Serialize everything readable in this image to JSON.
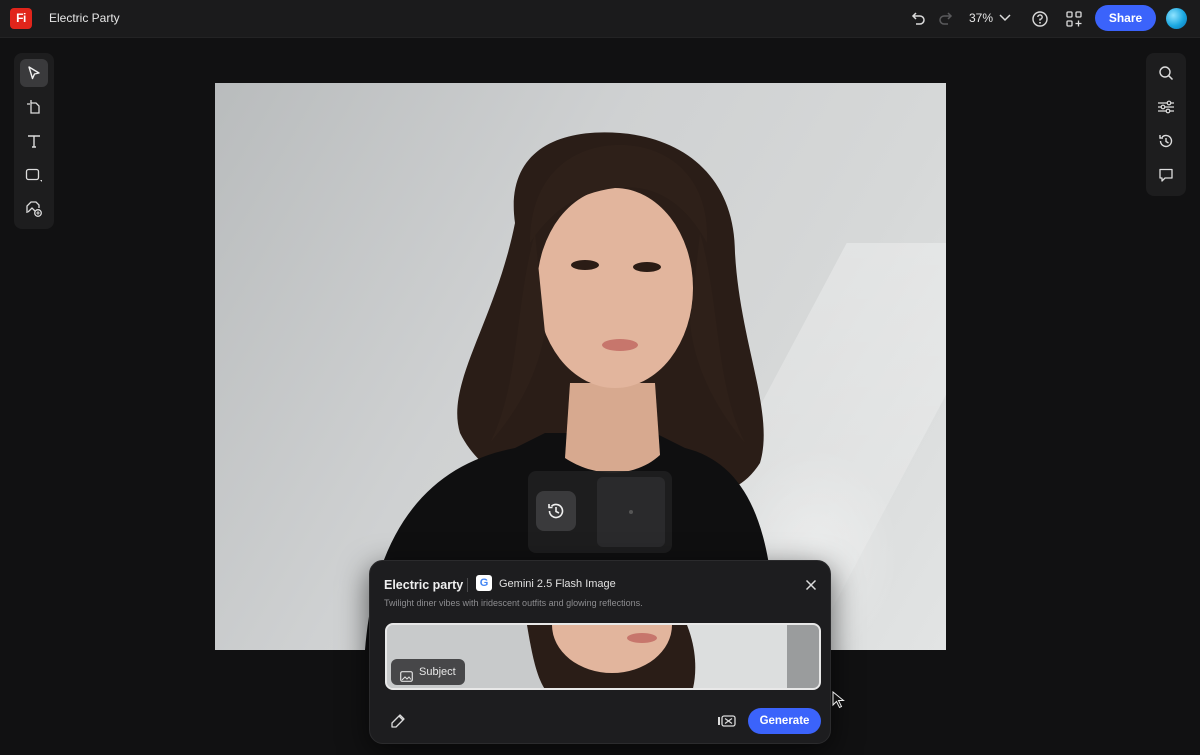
{
  "app": {
    "logo_text": "Fi",
    "document_title": "Electric Party",
    "brand_color": "#e1251b"
  },
  "topbar": {
    "undo_icon": "undo-icon",
    "redo_icon": "redo-icon",
    "zoom_label": "37%",
    "help_icon": "help-icon",
    "apps_icon": "apps-icon",
    "share_label": "Share",
    "accent_color": "#3b63fb"
  },
  "left_toolbar": {
    "items": [
      "select-tool",
      "artboard-tool",
      "text-tool",
      "shape-tool",
      "generate-image-tool"
    ]
  },
  "right_toolbar": {
    "items": [
      "search",
      "adjustments",
      "version-history",
      "comments"
    ]
  },
  "generate_panel": {
    "title": "Electric party",
    "model_name": "Gemini 2.5 Flash Image",
    "model_logo": "G",
    "description": "Twilight diner vibes with iridescent outfits and glowing reflections.",
    "reference_chip": "Subject",
    "generate_label": "Generate"
  }
}
